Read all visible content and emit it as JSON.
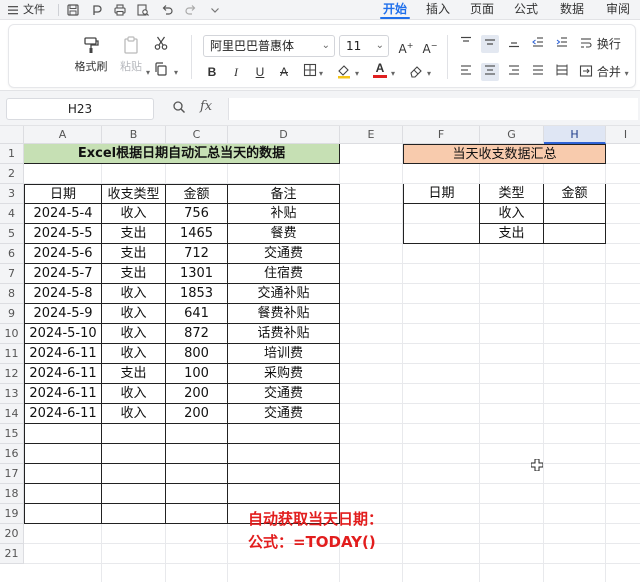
{
  "menubar": {
    "file_label": "文件",
    "tabs": [
      {
        "label": "开始",
        "active": true
      },
      {
        "label": "插入",
        "active": false
      },
      {
        "label": "页面",
        "active": false
      },
      {
        "label": "公式",
        "active": false
      },
      {
        "label": "数据",
        "active": false
      },
      {
        "label": "审阅",
        "active": false
      }
    ]
  },
  "ribbon": {
    "format_painter_label": "格式刷",
    "paste_label": "粘贴",
    "font_name": "阿里巴巴普惠体",
    "font_size": "11",
    "wrap_label": "换行",
    "merge_label": "合并",
    "font_color": "#e02020",
    "fill_color": "#f5c518",
    "accent_color": "#1f6feb"
  },
  "formula_bar": {
    "name_box": "H23",
    "formula": "",
    "fx_label": "fx"
  },
  "sheet": {
    "columns": [
      "A",
      "B",
      "C",
      "D",
      "E",
      "F",
      "G",
      "H",
      "I"
    ],
    "selected_column": "H",
    "rows": [
      "1",
      "2",
      "3",
      "4",
      "5",
      "6",
      "7",
      "8",
      "9",
      "10",
      "11",
      "12",
      "13",
      "14",
      "15",
      "16",
      "17",
      "18",
      "19",
      "20",
      "21"
    ],
    "title_left": "Excel根据日期自动汇总当天的数据",
    "title_left_bg": "#c6e0b4",
    "headers": [
      "日期",
      "收支类型",
      "金额",
      "备注"
    ],
    "records": [
      [
        "2024-5-4",
        "收入",
        "756",
        "补贴"
      ],
      [
        "2024-5-5",
        "支出",
        "1465",
        "餐费"
      ],
      [
        "2024-5-6",
        "支出",
        "712",
        "交通费"
      ],
      [
        "2024-5-7",
        "支出",
        "1301",
        "住宿费"
      ],
      [
        "2024-5-8",
        "收入",
        "1853",
        "交通补贴"
      ],
      [
        "2024-5-9",
        "收入",
        "641",
        "餐费补贴"
      ],
      [
        "2024-5-10",
        "收入",
        "872",
        "话费补贴"
      ],
      [
        "2024-6-11",
        "收入",
        "800",
        "培训费"
      ],
      [
        "2024-6-11",
        "支出",
        "100",
        "采购费"
      ],
      [
        "2024-6-11",
        "收入",
        "200",
        "交通费"
      ],
      [
        "2024-6-11",
        "收入",
        "200",
        "交通费"
      ]
    ],
    "summary_title": "当天收支数据汇总",
    "summary_title_bg": "#f8cbad",
    "summary_headers": [
      "日期",
      "类型",
      "金额"
    ],
    "summary_types": [
      "收入",
      "支出"
    ]
  },
  "annotation": {
    "line1": "自动获取当天日期：",
    "line2": "公式：=TODAY()",
    "color": "#e21d1d"
  }
}
